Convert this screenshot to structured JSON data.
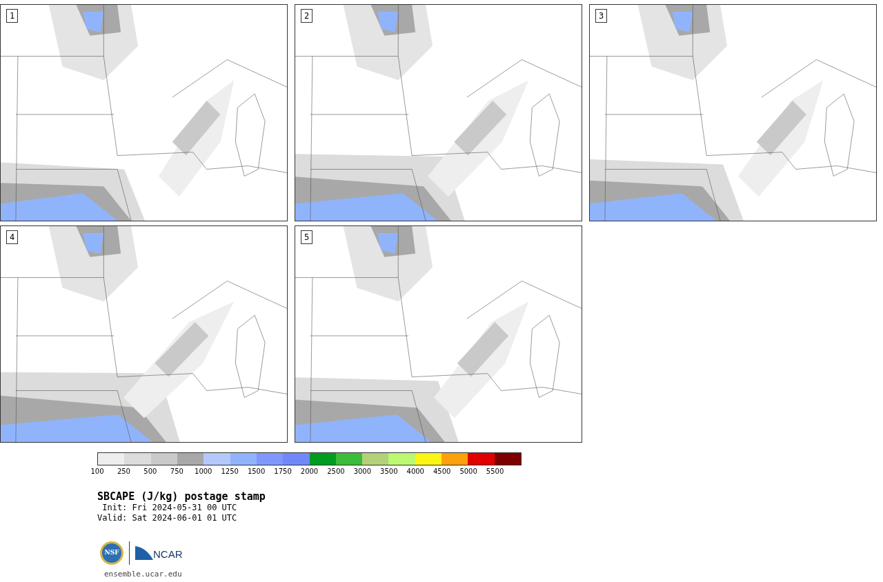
{
  "panels": [
    {
      "label": "1"
    },
    {
      "label": "2"
    },
    {
      "label": "3"
    },
    {
      "label": "4"
    },
    {
      "label": "5"
    }
  ],
  "colorbar": [
    {
      "label": "100",
      "color": "#eeeeee"
    },
    {
      "label": "250",
      "color": "#dcdcdc"
    },
    {
      "label": "500",
      "color": "#c9c9c9"
    },
    {
      "label": "750",
      "color": "#a8a8a8"
    },
    {
      "label": "1000",
      "color": "#b4c8fc"
    },
    {
      "label": "1250",
      "color": "#90b4fc"
    },
    {
      "label": "1500",
      "color": "#8098fc"
    },
    {
      "label": "1750",
      "color": "#7088f8"
    },
    {
      "label": "2000",
      "color": "#009c20"
    },
    {
      "label": "2500",
      "color": "#3cbc3c"
    },
    {
      "label": "3000",
      "color": "#b4d078"
    },
    {
      "label": "3500",
      "color": "#bcf870"
    },
    {
      "label": "4000",
      "color": "#fcf414"
    },
    {
      "label": "4500",
      "color": "#fca00c"
    },
    {
      "label": "5000",
      "color": "#e00000"
    },
    {
      "label": "5500",
      "color": "#7c0000"
    }
  ],
  "title": "SBCAPE (J/kg) postage stamp",
  "init": " Init: Fri 2024-05-31 00 UTC",
  "valid": "Valid: Sat 2024-06-01 01 UTC",
  "logos": {
    "nsf": "NSF",
    "ncar": "NCAR"
  },
  "site": "ensemble.ucar.edu"
}
